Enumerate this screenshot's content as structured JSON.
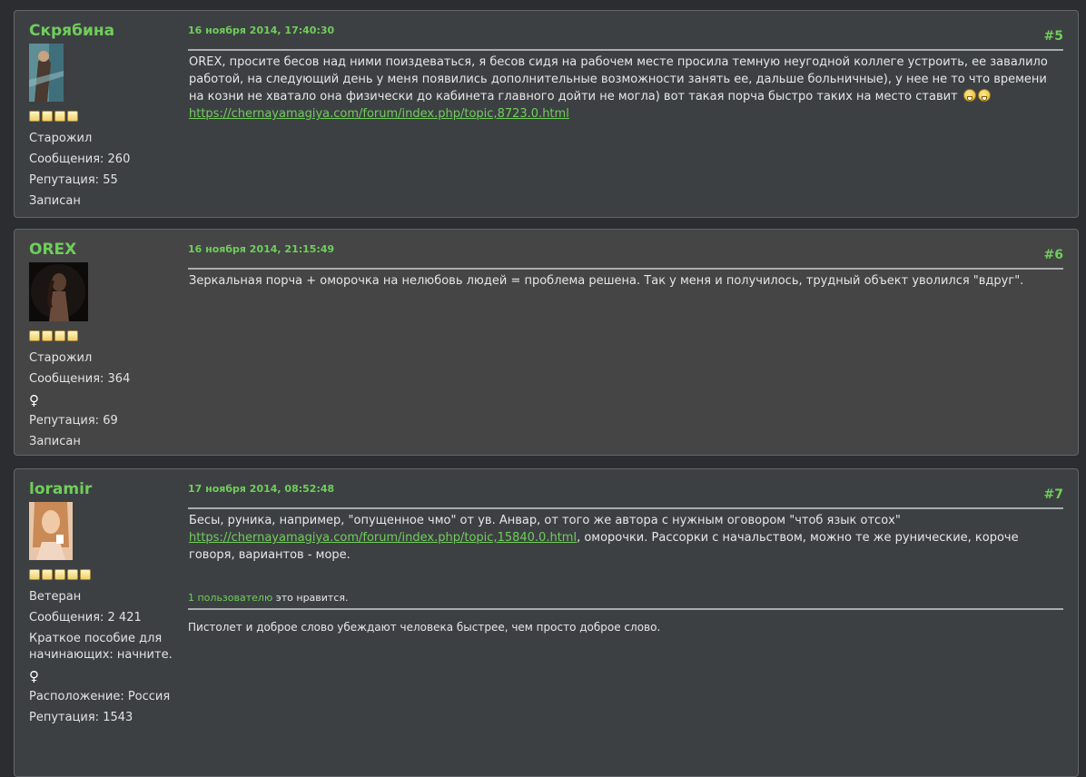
{
  "posts": [
    {
      "author": "Скрябина",
      "date": "16 ноября 2014, 17:40:30",
      "number": "#5",
      "stars": 4,
      "rank": "Старожил",
      "messages": "Сообщения: 260",
      "reputation": "Репутация: 55",
      "registered": "Записан",
      "text": "OREX, просите бесов над ними поиздеваться, я бесов сидя на рабочем месте просила темную неугодной коллеге устроить, ее завалило работой, на следующий день у меня появились дополнительные возможности занять ее, дальше больничные), у нее не то что времени на козни не хватало она физически до кабинета главного дойти не могла) вот такая порча быстро таких на место ставит",
      "link": "https://chernayamagiya.com/forum/index.php/topic,8723.0.html"
    },
    {
      "author": "OREX",
      "date": "16 ноября 2014, 21:15:49",
      "number": "#6",
      "stars": 4,
      "rank": "Старожил",
      "messages": "Сообщения: 364",
      "gender": "♀",
      "reputation": "Репутация: 69",
      "registered": "Записан",
      "text": "Зеркальная порча + оморочка на нелюбовь людей = проблема решена.  Так у меня и получилось, трудный объект уволился \"вдруг\"."
    },
    {
      "author": "loramir",
      "date": "17 ноября 2014, 08:52:48",
      "number": "#7",
      "stars": 5,
      "rank": "Ветеран",
      "messages": "Сообщения: 2 421",
      "title": "Краткое пособие для начинающих: начните.",
      "gender": "♀",
      "location": "Расположение: Россия",
      "reputation": "Репутация: 1543",
      "text_before": "Бесы, руника, например, \"опущенное чмо\" от ув. Анвар, от того же автора с нужным оговором \"чтоб язык отсох\"",
      "link": "https://chernayamagiya.com/forum/index.php/topic,15840.0.html",
      "text_after": ", оморочки. Рассорки с начальством, можно те же рунические, короче говоря, вариантов - море.",
      "likes_link": "1 пользователю",
      "likes_text": " это нравится.",
      "signature": "Пистолет и доброе слово убеждают человека быстрее, чем просто доброе слово."
    }
  ]
}
